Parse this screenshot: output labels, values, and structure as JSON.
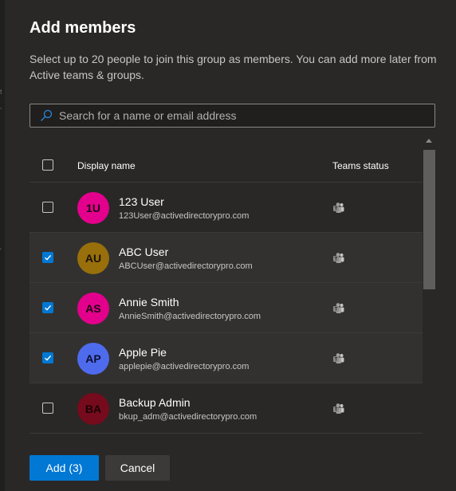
{
  "dialog": {
    "title": "Add members",
    "description": "Select up to 20 people to join this group as members. You can add more later from Active teams & groups."
  },
  "search": {
    "placeholder": "Search for a name or email address",
    "value": ""
  },
  "table": {
    "headers": {
      "display_name": "Display name",
      "teams_status": "Teams status"
    },
    "select_all_checked": false,
    "rows": [
      {
        "initials": "1U",
        "name": "123 User",
        "email": "123User@activedirectorypro.com",
        "checked": false,
        "avatar_color": "#e3008c",
        "avatar_text_color": "#1a0010"
      },
      {
        "initials": "AU",
        "name": "ABC User",
        "email": "ABCUser@activedirectorypro.com",
        "checked": true,
        "avatar_color": "#986f0b",
        "avatar_text_color": "#1a1200"
      },
      {
        "initials": "AS",
        "name": "Annie Smith",
        "email": "AnnieSmith@activedirectorypro.com",
        "checked": true,
        "avatar_color": "#e3008c",
        "avatar_text_color": "#1a0010"
      },
      {
        "initials": "AP",
        "name": "Apple Pie",
        "email": "applepie@activedirectorypro.com",
        "checked": true,
        "avatar_color": "#4f6bed",
        "avatar_text_color": "#0b1030"
      },
      {
        "initials": "BA",
        "name": "Backup Admin",
        "email": "bkup_adm@activedirectorypro.com",
        "checked": false,
        "avatar_color": "#750b1c",
        "avatar_text_color": "#1a0206"
      }
    ],
    "status_icon": "teams-icon"
  },
  "footer": {
    "add_label": "Add (3)",
    "cancel_label": "Cancel"
  },
  "colors": {
    "accent": "#0078d4",
    "dialog_bg": "#292827",
    "selected_row_bg": "#323130"
  }
}
